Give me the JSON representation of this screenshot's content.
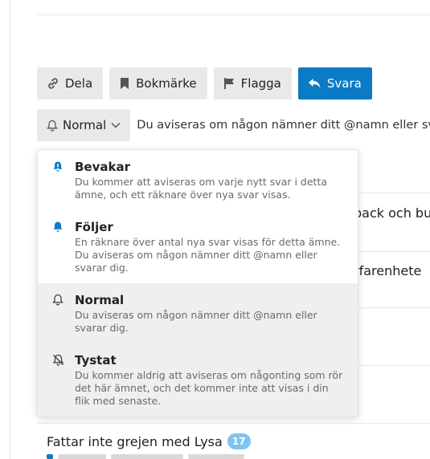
{
  "actions": {
    "share_label": "Dela",
    "bookmark_label": "Bokmärke",
    "flag_label": "Flagga",
    "reply_label": "Svara"
  },
  "notification": {
    "current_level": "Normal",
    "status_text": "Du aviseras om någon nämner ditt @namn eller svarar dig."
  },
  "dropdown": {
    "options": [
      {
        "title": "Bevakar",
        "description": "Du kommer att aviseras om varje nytt svar i detta ämne, och ett räknare över nya svar visas.",
        "icon": "bell-filled-icon"
      },
      {
        "title": "Följer",
        "description": "En räknare över antal nya svar visas för detta ämne. Du aviseras om någon nämner ditt @namn eller svarar dig.",
        "icon": "bell-filled-icon"
      },
      {
        "title": "Normal",
        "description": "Du aviseras om någon nämner ditt @namn eller svarar dig.",
        "icon": "bell-outline-icon",
        "selected": true
      },
      {
        "title": "Tystat",
        "description": "Du kommer aldrig att aviseras om någonting som rör det här ämnet, och det kommer inte att visas i din flik med senaste.",
        "icon": "bell-slash-icon"
      }
    ]
  },
  "background_topics": {
    "topic_fragment_1": "back och bu",
    "topic_fragment_2": "rfarenhete"
  },
  "suggested_topic": {
    "title": "Fattar inte grejen med Lysa",
    "count": "17"
  },
  "colors": {
    "primary": "#0a7bc4",
    "bell_accent": "#0a7bc4",
    "button_bg": "#e9e9e9",
    "badge": "#7fc4ee"
  }
}
